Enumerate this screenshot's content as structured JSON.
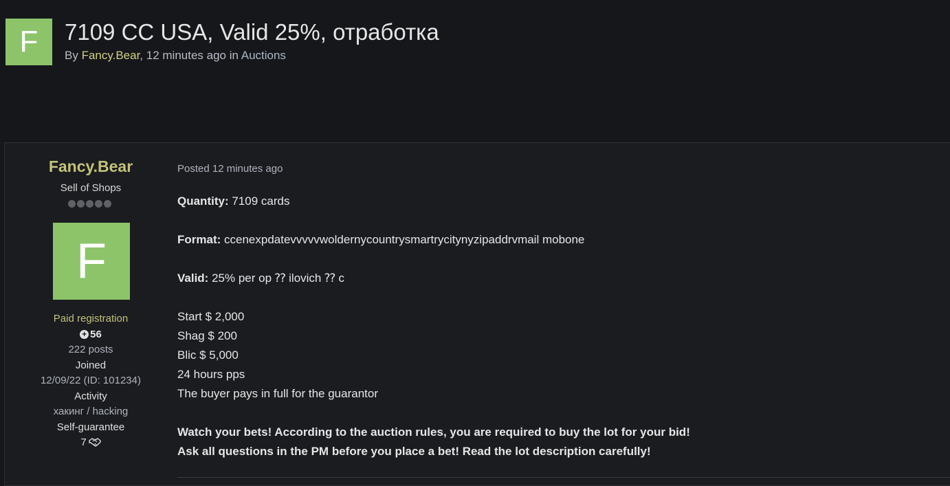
{
  "topic": {
    "avatar_letter": "F",
    "title": "7109 CC USA, Valid 25%, отработка",
    "meta_by": "By ",
    "author": "Fancy.Bear",
    "meta_time": ", 12 minutes ago in ",
    "forum": "Auctions"
  },
  "author_panel": {
    "name": "Fancy.Bear",
    "rank": "Sell of Shops",
    "rank_pips": 5,
    "avatar_letter": "F",
    "group": "Paid registration",
    "reputation": "56",
    "posts": "222 posts",
    "joined_label": "Joined",
    "joined_value": "12/09/22 (ID: 101234)",
    "activity_label": "Activity",
    "activity_value": "хакинг / hacking",
    "guarantee_label": "Self-guarantee",
    "guarantee_value": "7"
  },
  "post": {
    "date": "Posted 12 minutes ago",
    "quantity_label": "Quantity:",
    "quantity_value": " 7109 cards",
    "format_label": "Format:",
    "format_value": " ccenexpdatevvvvvwoldernycountrysmartrycitynyzipaddrvmail mobone",
    "valid_label": "Valid:",
    "valid_value": " 25% per op ⁇ ilovich ⁇ c",
    "start": "Start $ 2,000",
    "shag": "Shag $ 200",
    "blic": "Blic $ 5,000",
    "hours": "24 hours pps",
    "buyer": "The buyer pays in full for the guarantor",
    "warning1": "Watch your bets! According to the auction rules, you are required to buy the lot for your bid!",
    "warning2": "Ask all questions in the PM before you place a bet! Read the lot description carefully!"
  },
  "colors": {
    "background": "#16171b",
    "post_background": "#1b1c20",
    "avatar": "#8dc46a",
    "author_name": "#c3c27a"
  }
}
